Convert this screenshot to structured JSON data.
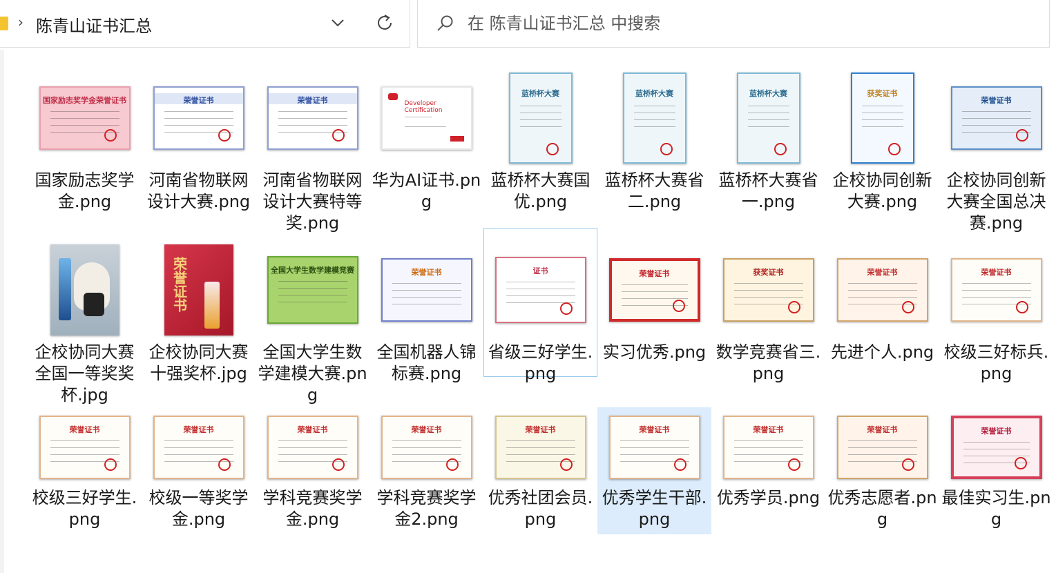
{
  "address_bar": {
    "breadcrumb": "陈青山证书汇总"
  },
  "search": {
    "placeholder": "在 陈青山证书汇总 中搜索"
  },
  "icons": {
    "folder": "folder-icon",
    "chevron": "chevron-right-icon",
    "dropdown": "chevron-down-icon",
    "refresh": "refresh-icon",
    "search": "search-icon"
  },
  "files": [
    {
      "name": "国家励志奖学金.png",
      "style": "pink",
      "title": "国家励志奖学金荣誉证书"
    },
    {
      "name": "河南省物联网设计大赛.png",
      "style": "white-blue",
      "title": "荣誉证书"
    },
    {
      "name": "河南省物联网设计大赛特等奖.png",
      "style": "white-blue",
      "title": "荣誉证书"
    },
    {
      "name": "华为AI证书.png",
      "style": "huawei",
      "title": "Developer Certification"
    },
    {
      "name": "蓝桥杯大赛国优.png",
      "style": "lanqiao",
      "title": "蓝桥杯大赛"
    },
    {
      "name": "蓝桥杯大赛省二.png",
      "style": "lanqiao",
      "title": "蓝桥杯大赛"
    },
    {
      "name": "蓝桥杯大赛省一.png",
      "style": "lanqiao",
      "title": "蓝桥杯大赛"
    },
    {
      "name": "企校协同创新大赛.png",
      "style": "award",
      "title": "获奖证书"
    },
    {
      "name": "企校协同创新大赛全国总决赛.png",
      "style": "blue-honor",
      "title": "荣誉证书"
    },
    {
      "name": "企校协同大赛全国一等奖奖杯.jpg",
      "style": "photo-bear",
      "title": ""
    },
    {
      "name": "企校协同大赛十强奖杯.jpg",
      "style": "photo-red",
      "title": "荣誉证书"
    },
    {
      "name": "全国大学生数学建模大赛.png",
      "style": "green",
      "title": "全国大学生数学建模竞赛"
    },
    {
      "name": "全国机器人锦标赛.png",
      "style": "robot",
      "title": "荣誉证书"
    },
    {
      "name": "省级三好学生.png",
      "style": "red-border",
      "title": "证书"
    },
    {
      "name": "实习优秀.png",
      "style": "red-frame",
      "title": "荣誉证书"
    },
    {
      "name": "数学竞赛省三.png",
      "style": "gold",
      "title": "获奖证书"
    },
    {
      "name": "先进个人.png",
      "style": "gold2",
      "title": "荣誉证书"
    },
    {
      "name": "校级三好标兵.png",
      "style": "school",
      "title": "荣誉证书"
    },
    {
      "name": "校级三好学生.png",
      "style": "school",
      "title": "荣誉证书"
    },
    {
      "name": "校级一等奖学金.png",
      "style": "school",
      "title": "荣誉证书"
    },
    {
      "name": "学科竞赛奖学金.png",
      "style": "school",
      "title": "荣誉证书"
    },
    {
      "name": "学科竞赛奖学金2.png",
      "style": "school",
      "title": "荣誉证书"
    },
    {
      "name": "优秀社团会员.png",
      "style": "cream",
      "title": "荣誉证书"
    },
    {
      "name": "优秀学生干部.png",
      "style": "school",
      "title": "荣誉证书"
    },
    {
      "name": "优秀学员.png",
      "style": "school",
      "title": "荣誉证书"
    },
    {
      "name": "优秀志愿者.png",
      "style": "gold2",
      "title": "荣誉证书"
    },
    {
      "name": "最佳实习生.png",
      "style": "pink-red",
      "title": "荣誉证书"
    }
  ],
  "selection": {
    "outlined": "省级三好学生.png",
    "highlighted": "优秀学生干部.png"
  }
}
